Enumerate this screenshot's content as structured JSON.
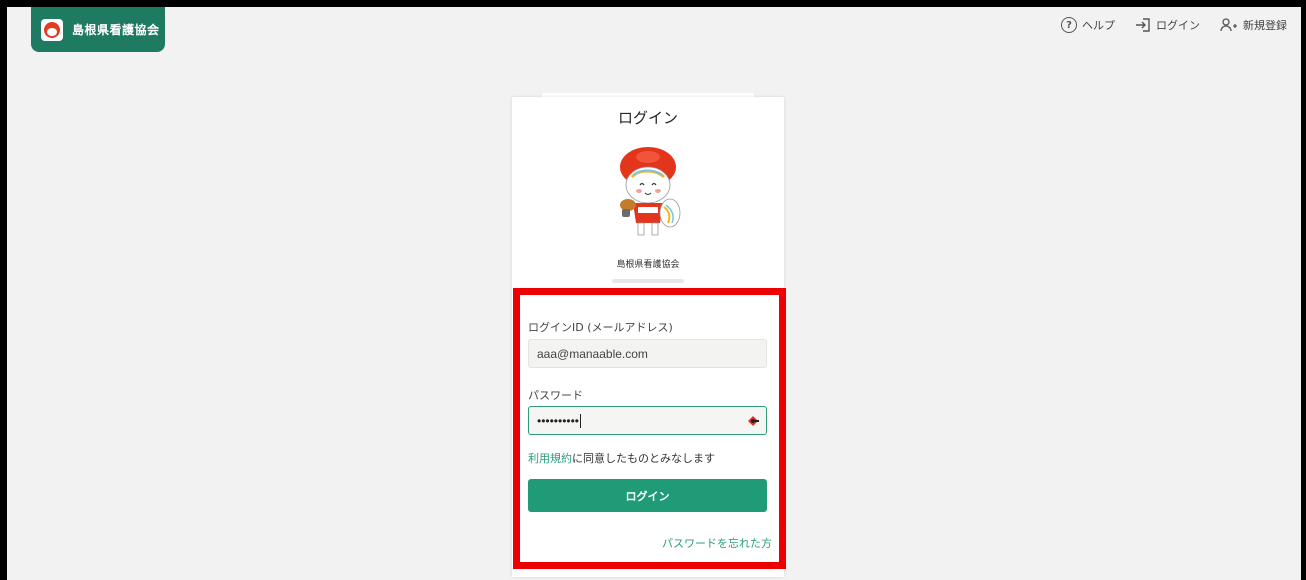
{
  "header": {
    "brand_name": "島根県看護協会",
    "nav": [
      {
        "label": "ヘルプ",
        "icon": "help-circle-icon"
      },
      {
        "label": "ログイン",
        "icon": "login-arrow-icon"
      },
      {
        "label": "新規登録",
        "icon": "user-add-icon"
      }
    ]
  },
  "login_card": {
    "title": "ログイン",
    "org_name": "島根県看護協会",
    "id_label": "ログインID (メールアドレス)",
    "id_value": "aaa@manaable.com",
    "password_label": "パスワード",
    "password_value": "••••••••••",
    "terms_link": "利用規約",
    "terms_text": "に同意したものとみなします",
    "login_button": "ログイン",
    "forgot_link": "パスワードを忘れた方"
  },
  "colors": {
    "brand": "#1f7a62",
    "accent": "#1f9c77",
    "highlight": "#ec0000"
  }
}
